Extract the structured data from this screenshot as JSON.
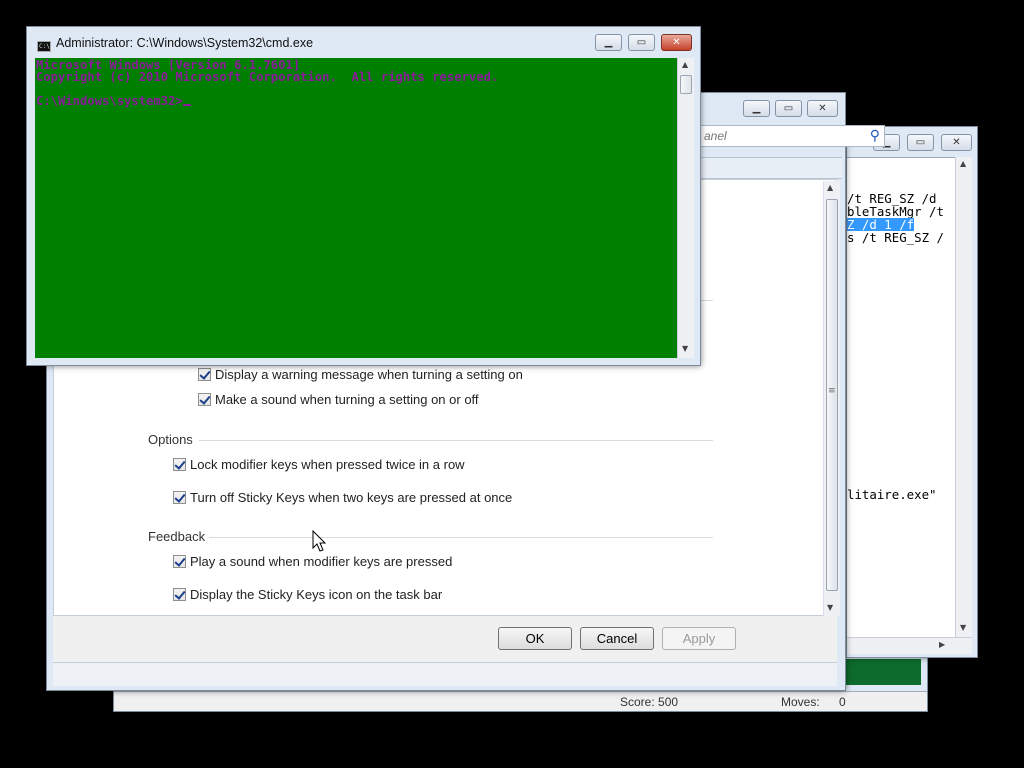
{
  "solitaire": {
    "score": "Score: 500",
    "moves_label": "Moves:",
    "moves_value": "0"
  },
  "reg": {
    "lines": [
      "/t REG_SZ /d",
      "bleTaskMgr /t",
      "s /t REG_SZ /"
    ],
    "highlight": "Z /d 1 /f",
    "tail": "litaire.exe\""
  },
  "sticky": {
    "search_placeholder": "anel",
    "checks_top": [
      "Display a warning message when turning a setting on",
      "Make a sound when turning a setting on or off"
    ],
    "options": {
      "heading": "Options",
      "items": [
        "Lock modifier keys when pressed twice in a row",
        "Turn off Sticky Keys when two keys are pressed at once"
      ]
    },
    "feedback": {
      "heading": "Feedback",
      "items": [
        "Play a sound when modifier keys are pressed",
        "Display the Sticky Keys icon on the task bar"
      ]
    },
    "buttons": {
      "ok": "OK",
      "cancel": "Cancel",
      "apply": "Apply"
    }
  },
  "cmd": {
    "title": "Administrator: C:\\Windows\\System32\\cmd.exe",
    "console_lines": [
      "Microsoft Windows [Version 6.1.7601]",
      "Copyright (c) 2010 Microsoft Corporation.  All rights reserved.",
      "",
      "C:\\Windows\\system32>"
    ],
    "colors": {
      "background": "#008000",
      "text": "#8b1b9a"
    }
  }
}
